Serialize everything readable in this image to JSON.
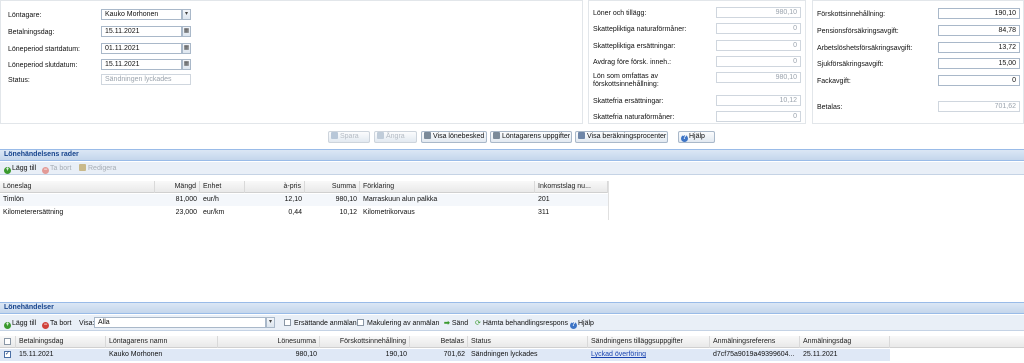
{
  "header_left": {
    "employee_label": "Löntagare:",
    "employee_value": "Kauko Morhonen",
    "paydate_label": "Betalningsdag:",
    "paydate_value": "15.11.2021",
    "period_start_label": "Löneperiod startdatum:",
    "period_start_value": "01.11.2021",
    "period_end_label": "Löneperiod slutdatum:",
    "period_end_value": "15.11.2021",
    "status_label": "Status:",
    "status_value": "Sändningen lyckades"
  },
  "summary_mid": {
    "rows": [
      {
        "label": "Löner och tillägg:",
        "value": "980,10"
      },
      {
        "label": "Skattepliktiga naturaförmåner:",
        "value": "0"
      },
      {
        "label": "Skattepliktiga ersättningar:",
        "value": "0"
      },
      {
        "label": "Avdrag före försk. inneh.:",
        "value": "0"
      },
      {
        "label": "Lön som omfattas av förskottsinnehållning:",
        "value": "980,10"
      },
      {
        "label": "Skattefria ersättningar:",
        "value": "10,12"
      },
      {
        "label": "Skattefria naturaförmåner:",
        "value": "0"
      }
    ]
  },
  "summary_right": {
    "rows": [
      {
        "label": "Förskottsinnehållning:",
        "value": "190,10"
      },
      {
        "label": "Pensionsförsäkringsavgift:",
        "value": "84,78"
      },
      {
        "label": "Arbetslöshetsförsäkringsavgift:",
        "value": "13,72"
      },
      {
        "label": "Sjukförsäkringsavgift:",
        "value": "15,00"
      },
      {
        "label": "Fackavgift:",
        "value": "0"
      }
    ],
    "net_label": "Betalas:",
    "net_value": "701,62"
  },
  "actions": {
    "save": "Spara",
    "undo": "Ångra",
    "payslip": "Visa lönebesked",
    "employee_info": "Löntagarens uppgifter",
    "calc_percent": "Visa beräkningsprocenter",
    "help": "Hjälp"
  },
  "rows_section": {
    "title": "Lönehändelsens rader",
    "add": "Lägg till",
    "remove": "Ta bort",
    "edit": "Redigera",
    "columns": [
      "Löneslag",
      "Mängd",
      "Enhet",
      "à-pris",
      "Summa",
      "Förklaring",
      "Inkomstslag nu..."
    ],
    "rows": [
      [
        "Timlön",
        "81,000",
        "eur/h",
        "12,10",
        "980,10",
        "Marraskuun alun palkka",
        "201"
      ],
      [
        "Kilometerersättning",
        "23,000",
        "eur/km",
        "0,44",
        "10,12",
        "Kilometrikorvaus",
        "311"
      ]
    ]
  },
  "events_section": {
    "title": "Lönehändelser",
    "add": "Lägg till",
    "remove": "Ta bort",
    "show_label": "Visa:",
    "show_value": "Alla",
    "replacing_label": "Ersättande anmälan",
    "cancel_label": "Makulering av anmälan",
    "send": "Sänd",
    "fetch": "Hämta behandlingsrespons",
    "help": "Hjälp",
    "columns": [
      "Betalningsdag",
      "Löntagarens namn",
      "Lönesumma",
      "Förskottsinnehållning",
      "Betalas",
      "Status",
      "Sändningens tilläggsuppgifter",
      "Anmälningsreferens",
      "Anmälningsdag"
    ],
    "rows": [
      [
        "15.11.2021",
        "Kauko Morhonen",
        "980,10",
        "190,10",
        "701,62",
        "Sändningen lyckades",
        "Lyckad överföring",
        "d7cf75a9019a49399604...",
        "25.11.2021"
      ]
    ]
  },
  "colors": {
    "header_blue": "#15428b",
    "link": "#1a44b0",
    "accent_green": "#3a9a2e",
    "accent_red": "#d0413a"
  }
}
